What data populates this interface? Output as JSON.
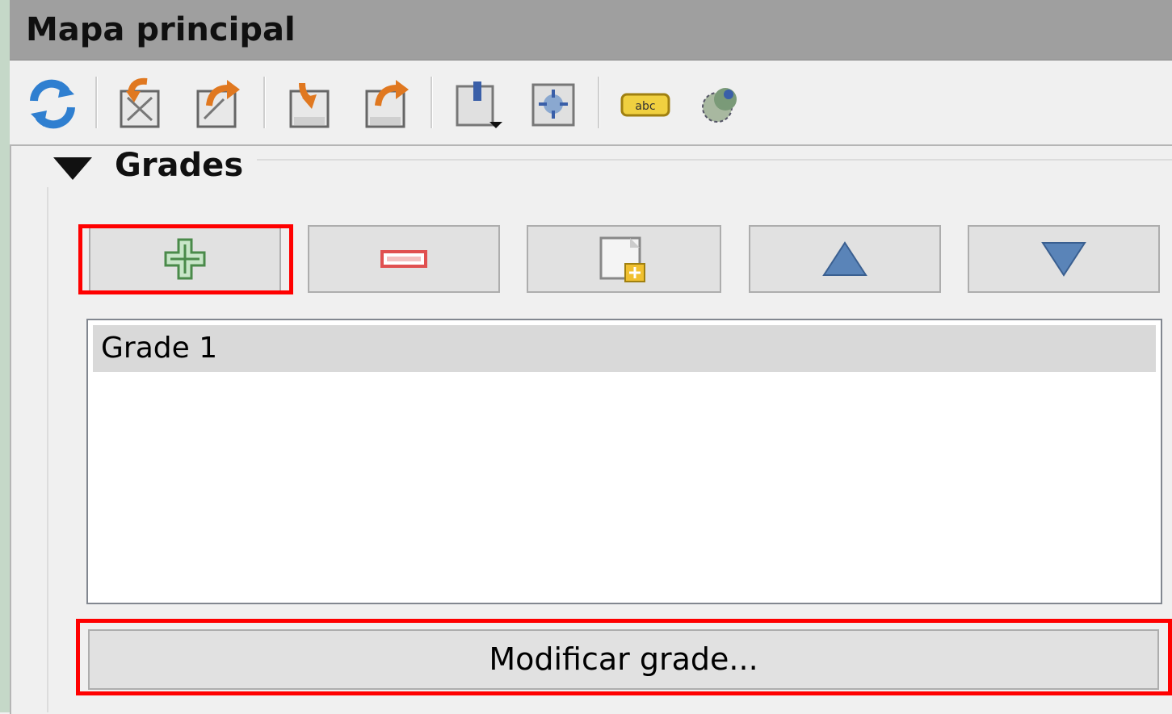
{
  "window": {
    "title": "Mapa principal"
  },
  "toolbar": {
    "icons": [
      "refresh-icon",
      "raise-item-icon",
      "export-icon",
      "lower-item-icon",
      "export-grid-icon",
      "bookmark-icon",
      "scale-icon",
      "label-icon",
      "atlas-icon"
    ]
  },
  "grids_group": {
    "title": "Grades",
    "items": [
      "Grade 1"
    ],
    "modify_label": "Modificar grade..."
  },
  "colors": {
    "title_bar": "#9f9f9f",
    "highlight": "#ff0000",
    "add_icon": "#4a8a4a",
    "remove_icon": "#e05050",
    "arrow_icon": "#5a84b8"
  }
}
